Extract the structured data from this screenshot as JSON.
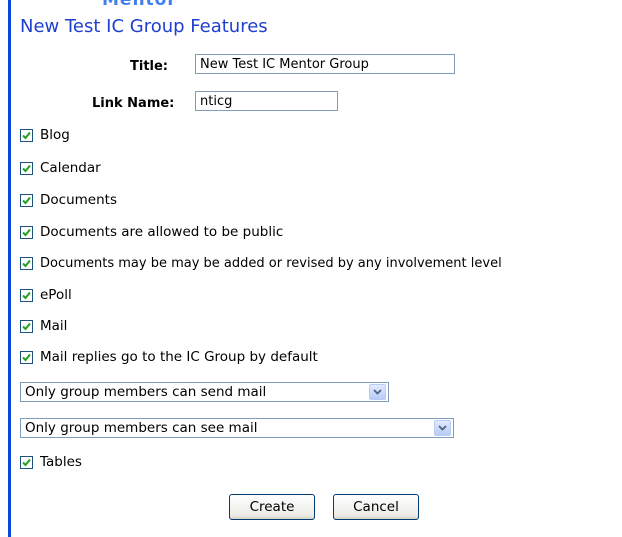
{
  "header": {
    "cut_text": "Mentor",
    "title": "New Test IC Group Features"
  },
  "form": {
    "title_label": "Title:",
    "title_value": "New Test IC Mentor Group",
    "link_label": "Link Name:",
    "link_value": "nticg"
  },
  "options": [
    {
      "label": "Blog",
      "checked": true
    },
    {
      "label": "Calendar",
      "checked": true
    },
    {
      "label": "Documents",
      "checked": true
    },
    {
      "label": "Documents are allowed to be public",
      "checked": true
    },
    {
      "label": "Documents may be may be added or revised by any involvement level",
      "checked": true
    },
    {
      "label": "ePoll",
      "checked": true
    },
    {
      "label": "Mail",
      "checked": true
    },
    {
      "label": "Mail replies go to the IC Group by default",
      "checked": true
    }
  ],
  "selects": {
    "send_mail": "Only group members can send mail",
    "see_mail": "Only group members can see mail"
  },
  "tables": {
    "label": "Tables",
    "checked": true
  },
  "buttons": {
    "create": "Create",
    "cancel": "Cancel"
  },
  "colors": {
    "accent_bar": "#0a46d8",
    "title": "#1f3fd0",
    "checkmark": "#21a121"
  }
}
